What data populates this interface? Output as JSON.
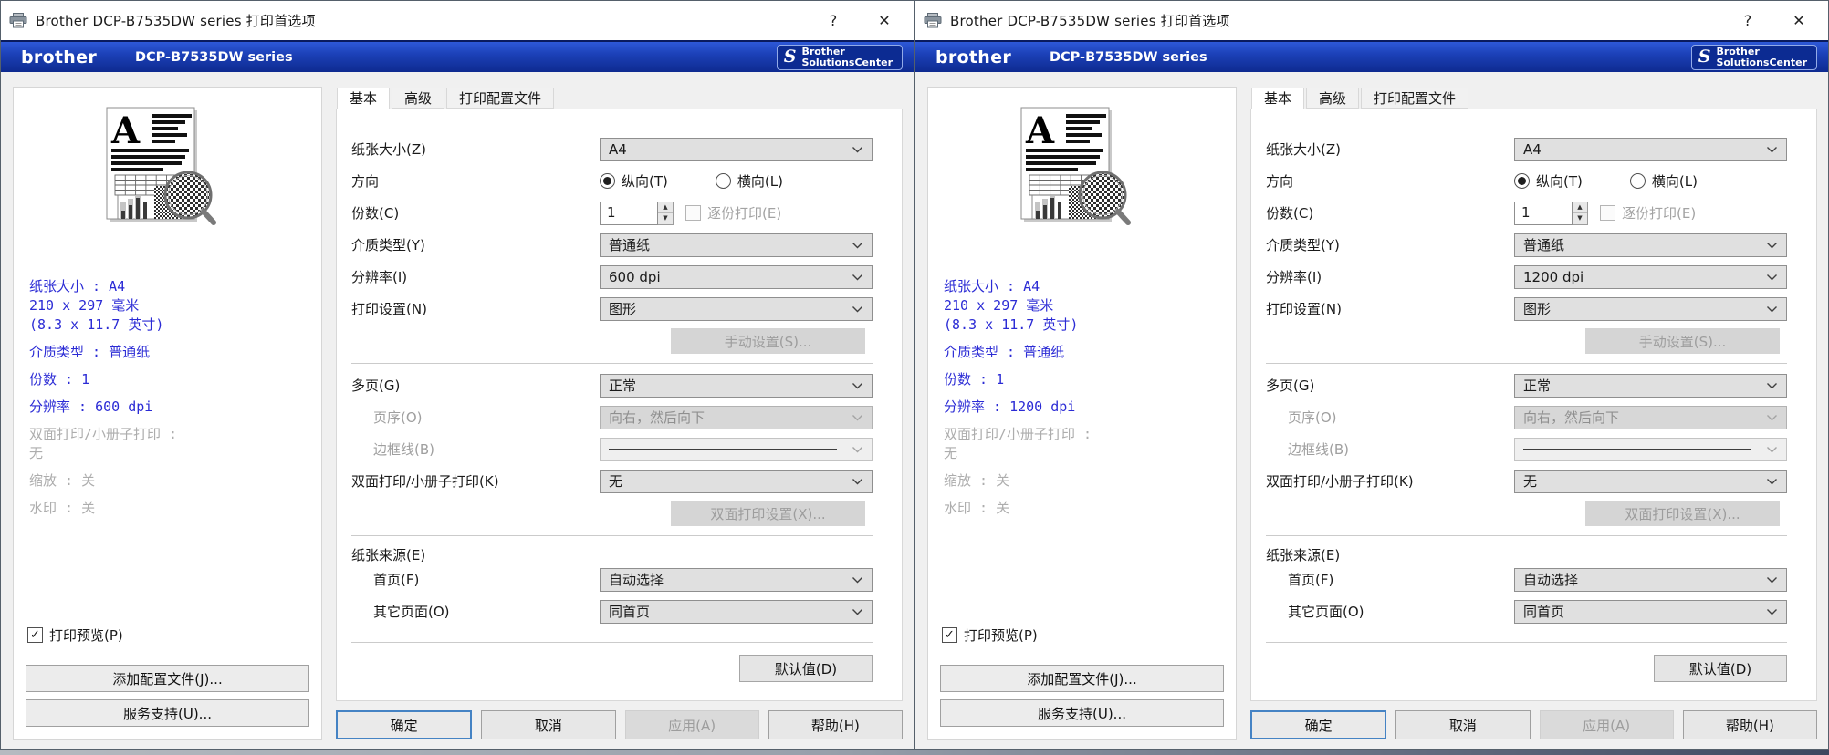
{
  "colors": {
    "banner_blue_top": "#2e59d8",
    "banner_blue_bottom": "#0e2a90",
    "summary_text_blue": "#2b2bd5",
    "disabled_text_gray": "#9d9d9d",
    "focus_border_blue": "#4583c4",
    "dialog_background": "#f0f0f0"
  },
  "icons": {
    "check": "✓",
    "spin_up": "▲",
    "spin_down": "▼"
  },
  "shared": {
    "titlebar": {
      "title": "Brother DCP-B7535DW series 打印首选项",
      "help": "?",
      "close": "✕"
    },
    "banner": {
      "logo": "brother",
      "model": "DCP-B7535DW series",
      "sc_icon": "S",
      "sc_line1": "Brother",
      "sc_line2": "SolutionsCenter"
    },
    "tabs": {
      "basic": "基本",
      "advanced": "高级",
      "profiles": "打印配置文件"
    },
    "form": {
      "paper_size": "纸张大小(Z)",
      "orientation": "方向",
      "portrait": "纵向(T)",
      "landscape": "横向(L)",
      "copies": "份数(C)",
      "collate": "逐份打印(E)",
      "media_type": "介质类型(Y)",
      "resolution": "分辨率(I)",
      "print_settings": "打印设置(N)",
      "manual_settings": "手动设置(S)...",
      "multiple_page": "多页(G)",
      "page_order": "页序(O)",
      "border_line": "边框线(B)",
      "duplex": "双面打印/小册子打印(K)",
      "duplex_settings": "双面打印设置(X)...",
      "paper_source": "纸张来源(E)",
      "first_page": "首页(F)",
      "other_pages": "其它页面(O)",
      "defaults": "默认值(D)"
    },
    "values": {
      "paper_size": "A4",
      "copies": "1",
      "media_type": "普通纸",
      "print_settings": "图形",
      "multiple_page": "正常",
      "page_order": "向右，然后向下",
      "duplex": "无",
      "first_page": "自动选择",
      "other_pages": "同首页"
    },
    "summary": {
      "paper_size": "纸张大小 : A4",
      "dimensions_mm": "210 x 297 毫米",
      "dimensions_inch": "(8.3 x 11.7 英寸)",
      "media_type": "介质类型 : 普通纸",
      "copies": "份数 : 1",
      "duplex_line1": "双面打印/小册子打印 :",
      "duplex_line2": "无",
      "scaling": "缩放 : 关",
      "watermark": "水印 : 关"
    },
    "sidebar": {
      "print_preview": "打印预览(P)",
      "add_profile": "添加配置文件(J)...",
      "support": "服务支持(U)..."
    },
    "footer": {
      "ok": "确定",
      "cancel": "取消",
      "apply": "应用(A)",
      "help": "帮助(H)"
    }
  },
  "windows": {
    "left": {
      "resolution": "600 dpi",
      "summary_resolution": "分辨率 : 600 dpi"
    },
    "right": {
      "resolution": "1200 dpi",
      "summary_resolution": "分辨率 : 1200 dpi"
    }
  }
}
